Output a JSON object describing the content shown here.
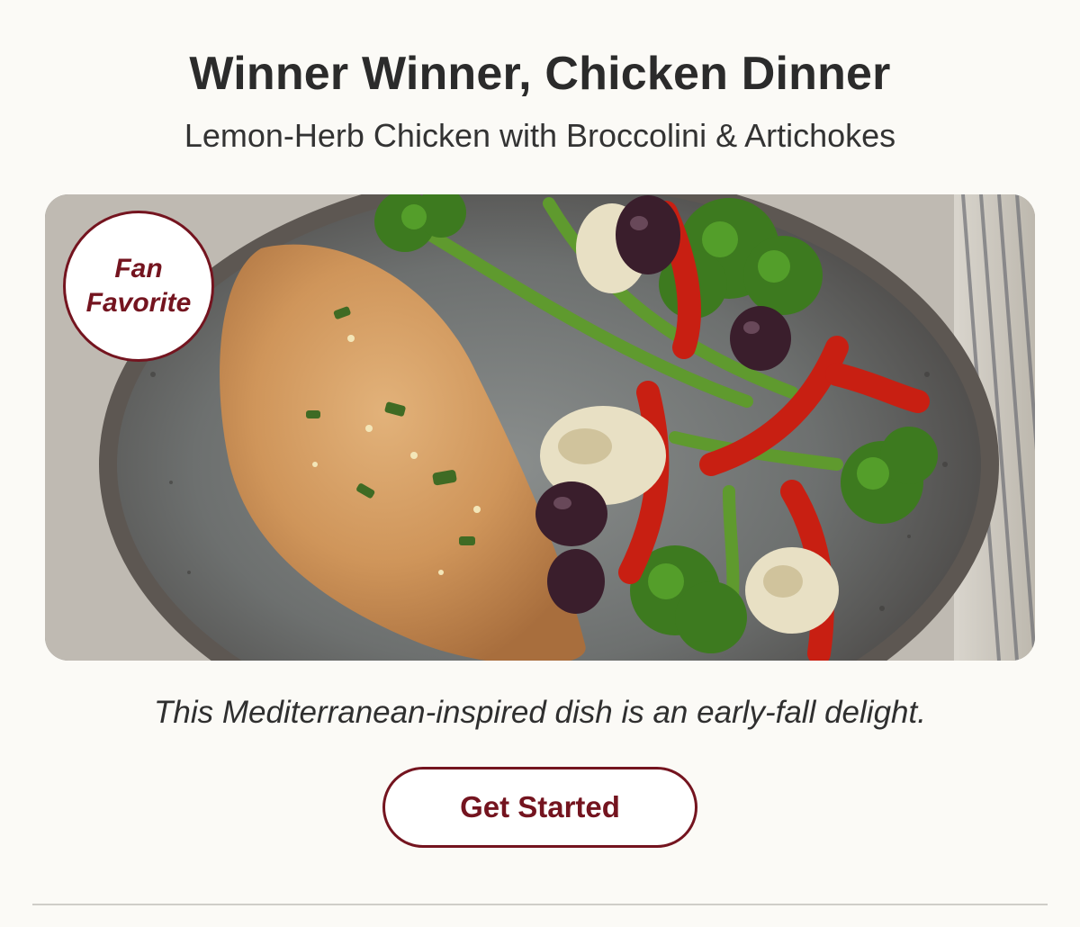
{
  "headline": "Winner Winner, Chicken Dinner",
  "subheadline": "Lemon-Herb Chicken with Broccolini & Artichokes",
  "hero": {
    "alt": "Lemon-Herb Chicken with Broccolini & Artichokes",
    "badge_line1": "Fan",
    "badge_line2": "Favorite"
  },
  "description": "This Mediterranean-inspired dish is an early-fall delight.",
  "cta_label": "Get Started",
  "colors": {
    "brand": "#74141f",
    "background": "#fbfaf6",
    "text": "#2b2b2b",
    "divider": "#cfcdc8"
  }
}
